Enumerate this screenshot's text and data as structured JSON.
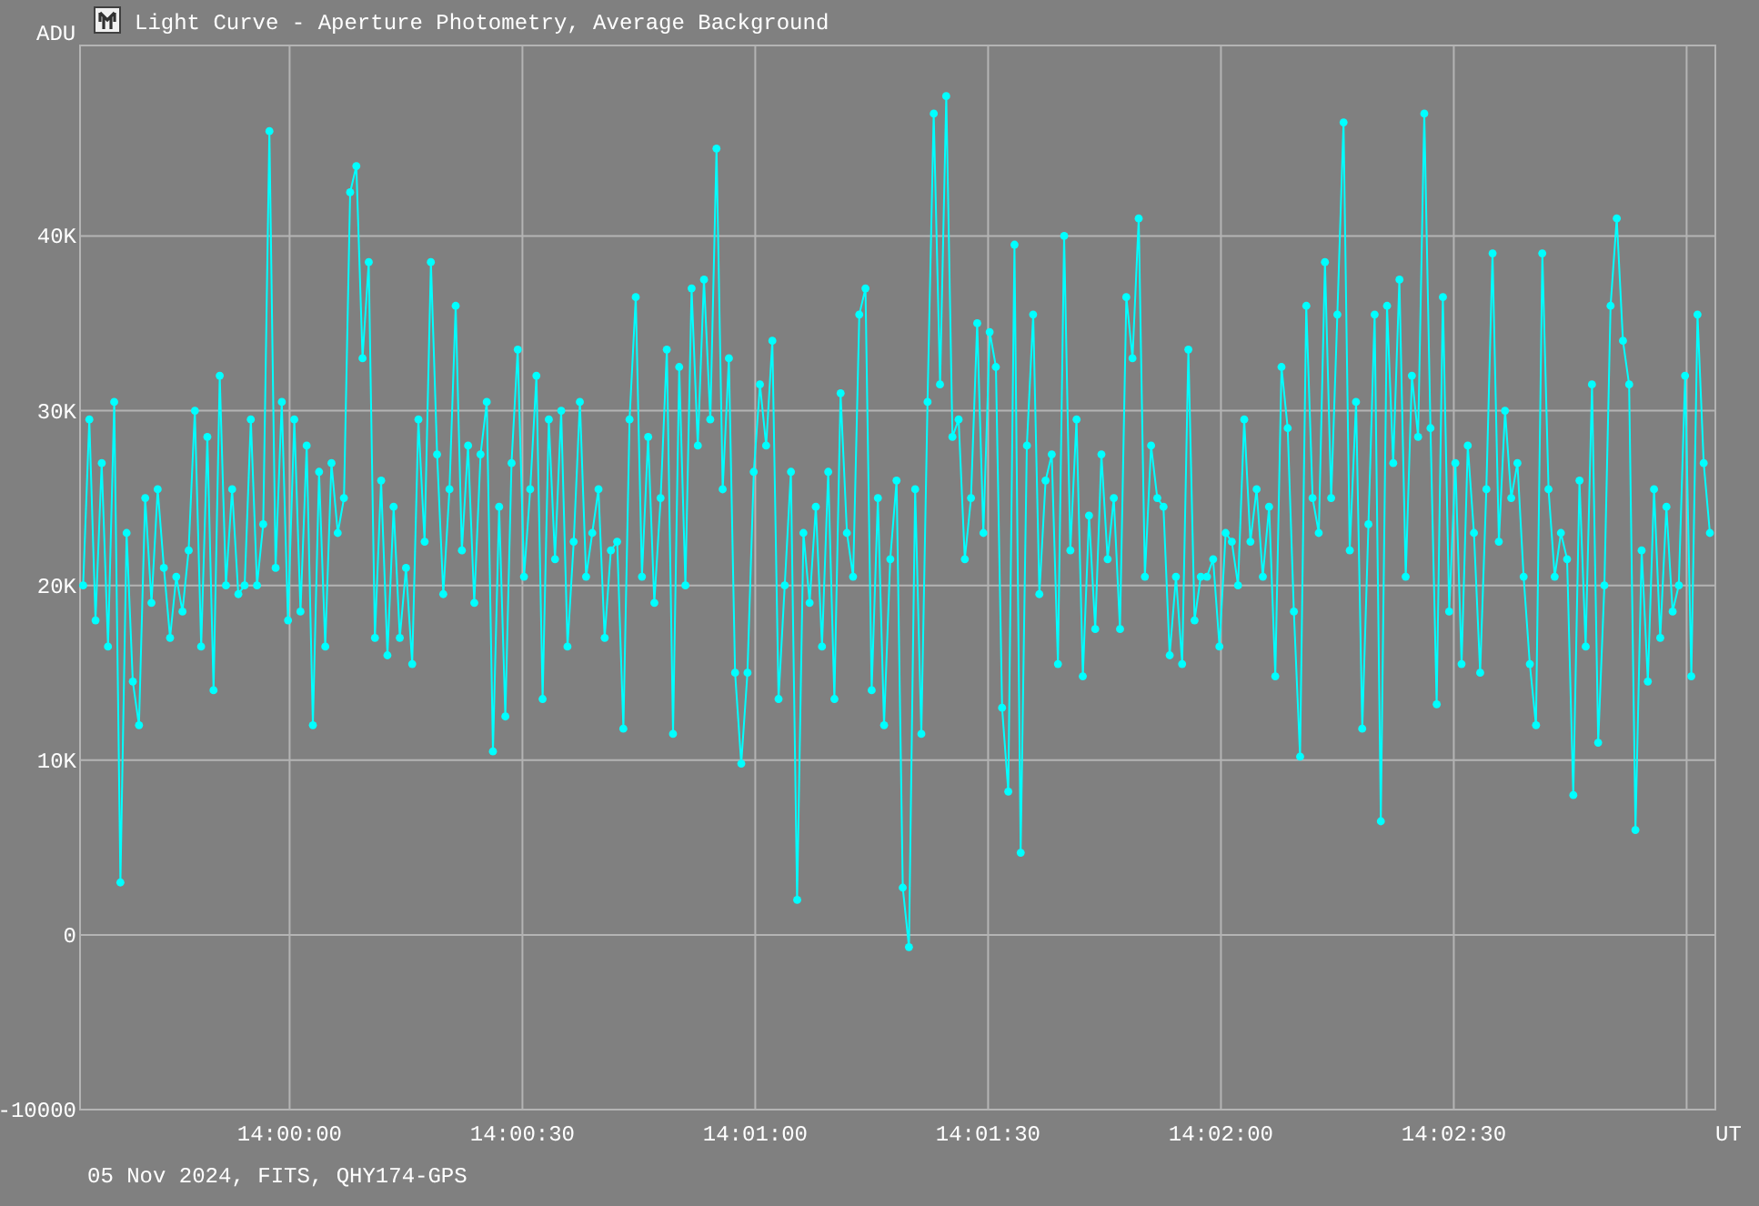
{
  "window": {
    "title": "Light Curve - Aperture Photometry, Average Background"
  },
  "chart": {
    "chart_data": {
      "type": "line",
      "ylabel": "ADU",
      "xlabel": "UT",
      "xlim": [
        50373,
        50583.7
      ],
      "ylim": [
        -10000,
        50900
      ],
      "grid": true,
      "x": [
        50373.4,
        50374.2,
        50375,
        50375.8,
        50376.6,
        50377.4,
        50378.2,
        50379,
        50379.8,
        50380.6,
        50381.4,
        50382.2,
        50383,
        50383.8,
        50384.6,
        50385.4,
        50386.2,
        50387,
        50387.8,
        50388.6,
        50389.4,
        50390.2,
        50391,
        50391.8,
        50392.6,
        50393.4,
        50394.2,
        50395,
        50395.8,
        50396.6,
        50397.4,
        50398.2,
        50399,
        50399.8,
        50400.6,
        50401.4,
        50402.2,
        50403,
        50403.8,
        50404.6,
        50405.4,
        50406.2,
        50407,
        50407.8,
        50408.6,
        50409.4,
        50410.2,
        50411,
        50411.8,
        50412.6,
        50413.4,
        50414.2,
        50415,
        50415.8,
        50416.6,
        50417.4,
        50418.2,
        50419,
        50419.8,
        50420.6,
        50421.4,
        50422.2,
        50423,
        50423.8,
        50424.6,
        50425.4,
        50426.2,
        50427,
        50427.8,
        50428.6,
        50429.4,
        50430.2,
        50431,
        50431.8,
        50432.6,
        50433.4,
        50434.2,
        50435,
        50435.8,
        50436.6,
        50437.4,
        50438.2,
        50439,
        50439.8,
        50440.6,
        50441.4,
        50442.2,
        50443,
        50443.8,
        50444.6,
        50445.4,
        50446.2,
        50447,
        50447.8,
        50448.6,
        50449.4,
        50450.2,
        50451,
        50451.8,
        50452.6,
        50453.4,
        50454.2,
        50455,
        50455.8,
        50456.6,
        50457.4,
        50458.2,
        50459,
        50459.8,
        50460.6,
        50461.4,
        50462.2,
        50463,
        50463.8,
        50464.6,
        50465.4,
        50466.2,
        50467,
        50467.8,
        50468.6,
        50469.4,
        50470.2,
        50471,
        50471.8,
        50472.6,
        50473.4,
        50474.2,
        50475,
        50475.8,
        50476.6,
        50477.4,
        50478.2,
        50479,
        50479.8,
        50480.6,
        50481.4,
        50482.2,
        50483,
        50483.8,
        50484.6,
        50485.4,
        50486.2,
        50487,
        50487.8,
        50488.6,
        50489.4,
        50490.2,
        50491,
        50491.8,
        50492.6,
        50493.4,
        50494.2,
        50495,
        50495.8,
        50496.6,
        50497.4,
        50498.2,
        50499,
        50499.8,
        50500.6,
        50501.4,
        50502.2,
        50503,
        50503.8,
        50504.6,
        50505.4,
        50506.2,
        50507,
        50507.8,
        50508.6,
        50509.4,
        50510.2,
        50511,
        50511.8,
        50512.6,
        50513.4,
        50514.2,
        50515,
        50515.8,
        50516.6,
        50517.4,
        50518.2,
        50519,
        50519.8,
        50520.6,
        50521.4,
        50522.2,
        50523,
        50523.8,
        50524.6,
        50525.4,
        50526.2,
        50527,
        50527.8,
        50528.6,
        50529.4,
        50530.2,
        50531,
        50531.8,
        50532.6,
        50533.4,
        50534.2,
        50535,
        50535.8,
        50536.6,
        50537.4,
        50538.2,
        50539,
        50539.8,
        50540.6,
        50541.4,
        50542.2,
        50543,
        50543.8,
        50544.6,
        50545.4,
        50546.2,
        50547,
        50547.8,
        50548.6,
        50549.4,
        50550.2,
        50551,
        50551.8,
        50552.6,
        50553.4,
        50554.2,
        50555,
        50555.8,
        50556.6,
        50557.4,
        50558.2,
        50559,
        50559.8,
        50560.6,
        50561.4,
        50562.2,
        50563,
        50563.8,
        50564.6,
        50565.4,
        50566.2,
        50567,
        50567.8,
        50568.6,
        50569.4,
        50570.2,
        50571,
        50571.8,
        50572.6,
        50573.4,
        50574.2,
        50575,
        50575.8,
        50576.6,
        50577.4,
        50578.2,
        50579,
        50579.8,
        50580.6,
        50581.4,
        50582.2,
        50583
      ],
      "xticks": [
        {
          "value": 50400,
          "label": "14:00:00"
        },
        {
          "value": 50430,
          "label": "14:00:30"
        },
        {
          "value": 50460,
          "label": "14:01:00"
        },
        {
          "value": 50490,
          "label": "14:01:30"
        },
        {
          "value": 50520,
          "label": "14:02:00"
        },
        {
          "value": 50550,
          "label": "14:02:30"
        },
        {
          "value": 50580,
          "label": null
        }
      ],
      "yticks": [
        {
          "value": -10000,
          "label": "-10000"
        },
        {
          "value": 0,
          "label": "0"
        },
        {
          "value": 10000,
          "label": "10K"
        },
        {
          "value": 20000,
          "label": "20K"
        },
        {
          "value": 30000,
          "label": "30K"
        },
        {
          "value": 40000,
          "label": "40K"
        }
      ],
      "series": [
        {
          "color": "#00ffff",
          "marker": "circle",
          "values": [
            20000,
            29500,
            18000,
            27000,
            16500,
            30500,
            3000,
            23000,
            14500,
            12000,
            25000,
            19000,
            25500,
            21000,
            17000,
            20500,
            18500,
            22000,
            30000,
            16500,
            28500,
            14000,
            32000,
            20000,
            25500,
            19500,
            20000,
            29500,
            20000,
            23500,
            46000,
            21000,
            30500,
            18000,
            29500,
            18500,
            28000,
            12000,
            26500,
            16500,
            27000,
            23000,
            25000,
            42500,
            44000,
            33000,
            38500,
            17000,
            26000,
            16000,
            24500,
            17000,
            21000,
            15500,
            29500,
            22500,
            38500,
            27500,
            19500,
            25500,
            36000,
            22000,
            28000,
            19000,
            27500,
            30500,
            10500,
            24500,
            12500,
            27000,
            33500,
            20500,
            25500,
            32000,
            13500,
            29500,
            21500,
            30000,
            16500,
            22500,
            30500,
            20500,
            23000,
            25500,
            17000,
            22000,
            22500,
            11800,
            29500,
            36500,
            20500,
            28500,
            19000,
            25000,
            33500,
            11500,
            32500,
            20000,
            37000,
            28000,
            37500,
            29500,
            45000,
            25500,
            33000,
            15000,
            9800,
            15000,
            26500,
            31500,
            28000,
            34000,
            13500,
            20000,
            26500,
            2000,
            23000,
            19000,
            24500,
            16500,
            26500,
            13500,
            31000,
            23000,
            20500,
            35500,
            37000,
            14000,
            25000,
            12000,
            21500,
            26000,
            2700,
            -700,
            25500,
            11500,
            30500,
            47000,
            31500,
            48000,
            28500,
            29500,
            21500,
            25000,
            35000,
            23000,
            34500,
            32500,
            13000,
            8200,
            39500,
            4700,
            28000,
            35500,
            19500,
            26000,
            27500,
            15500,
            40000,
            22000,
            29500,
            14800,
            24000,
            17500,
            27500,
            21500,
            25000,
            17500,
            36500,
            33000,
            41000,
            20500,
            28000,
            25000,
            24500,
            16000,
            20500,
            15500,
            33500,
            18000,
            20500,
            20500,
            21500,
            16500,
            23000,
            22500,
            20000,
            29500,
            22500,
            25500,
            20500,
            24500,
            14800,
            32500,
            29000,
            18500,
            10200,
            36000,
            25000,
            23000,
            38500,
            25000,
            35500,
            46500,
            22000,
            30500,
            11800,
            23500,
            35500,
            6500,
            36000,
            27000,
            37500,
            20500,
            32000,
            28500,
            47000,
            29000,
            13200,
            36500,
            18500,
            27000,
            15500,
            28000,
            23000,
            15000,
            25500,
            39000,
            22500,
            30000,
            25000,
            27000,
            20500,
            15500,
            12000,
            39000,
            25500,
            20500,
            23000,
            21500,
            8000,
            26000,
            16500,
            31500,
            11000,
            20000,
            36000,
            41000,
            34000,
            31500,
            6000,
            22000,
            14500,
            25500,
            17000,
            24500,
            18500,
            20000,
            32000,
            14800,
            35500,
            27000,
            23000
          ]
        }
      ]
    }
  },
  "footer": "05 Nov 2024, FITS, QHY174-GPS"
}
